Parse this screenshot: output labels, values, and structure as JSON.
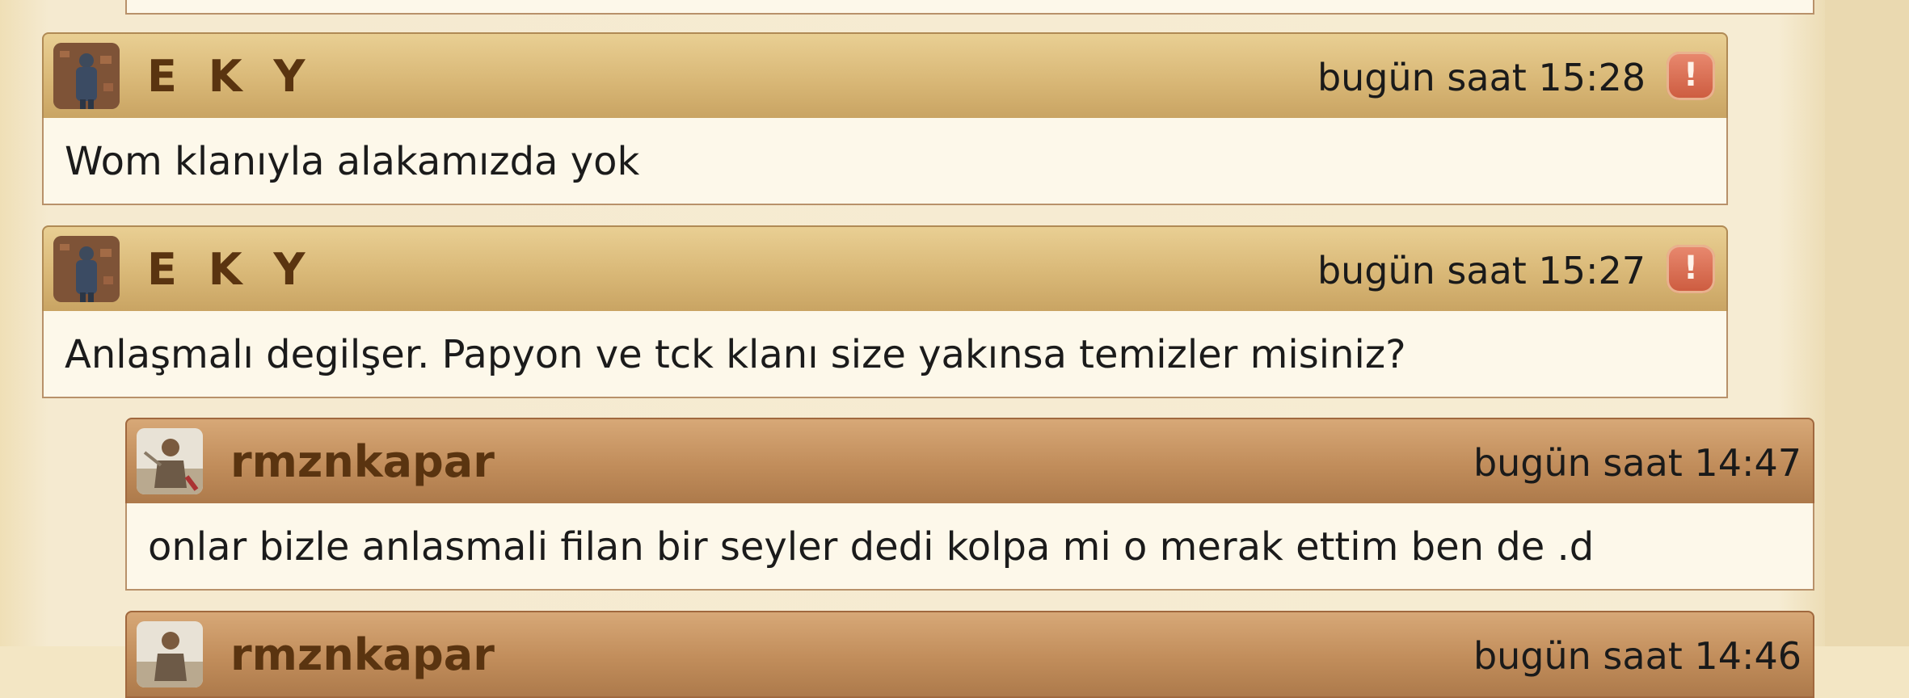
{
  "messages": [
    {
      "author": "E K Y",
      "time": "bugün saat 15:28",
      "text": "Wom klanıyla alakamızda yok",
      "report_icon": "!"
    },
    {
      "author": "E K Y",
      "time": "bugün saat 15:27",
      "text": "Anlaşmalı degilşer. Papyon ve tck klanı size yakınsa temizler misiniz?",
      "report_icon": "!"
    },
    {
      "author": "rmznkapar",
      "time": "bugün saat 14:47",
      "text": "onlar bizle anlasmali filan bir seyler dedi kolpa mi o merak ettim ben de .d"
    },
    {
      "author": "rmznkapar",
      "time": "bugün saat 14:46",
      "text": ""
    }
  ],
  "colors": {
    "mine_header": "#d9b877",
    "theirs_header": "#c18d5b",
    "body_bg": "#fdf8ea",
    "username": "#5a3410",
    "report": "#cc5a3e"
  }
}
